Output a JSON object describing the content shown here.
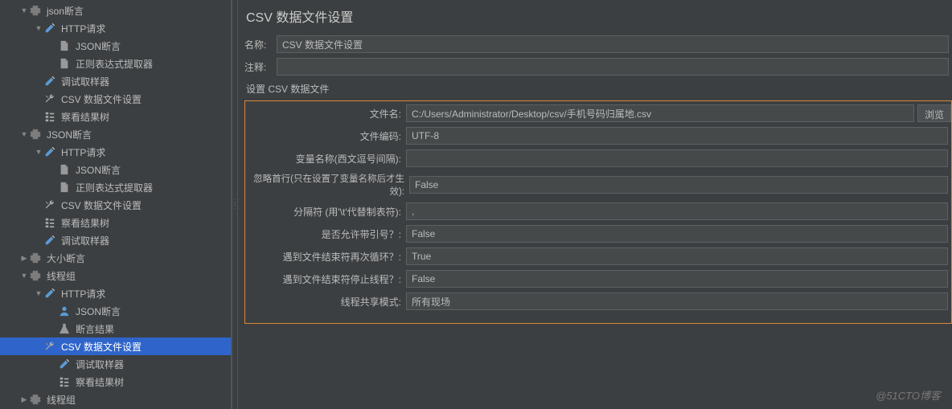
{
  "tree": [
    {
      "indent": 1,
      "arrow": "down",
      "icon": "gear",
      "label": "json断言"
    },
    {
      "indent": 2,
      "arrow": "down",
      "icon": "pen",
      "label": "HTTP请求"
    },
    {
      "indent": 3,
      "arrow": "",
      "icon": "doc",
      "label": "JSON断言"
    },
    {
      "indent": 3,
      "arrow": "",
      "icon": "doc",
      "label": "正则表达式提取器"
    },
    {
      "indent": 2,
      "arrow": "",
      "icon": "pen",
      "label": "调试取样器"
    },
    {
      "indent": 2,
      "arrow": "",
      "icon": "wrench",
      "label": "CSV 数据文件设置"
    },
    {
      "indent": 2,
      "arrow": "",
      "icon": "tree",
      "label": "察看结果树"
    },
    {
      "indent": 1,
      "arrow": "down",
      "icon": "gear",
      "label": "JSON断言"
    },
    {
      "indent": 2,
      "arrow": "down",
      "icon": "pen",
      "label": "HTTP请求"
    },
    {
      "indent": 3,
      "arrow": "",
      "icon": "doc",
      "label": "JSON断言"
    },
    {
      "indent": 3,
      "arrow": "",
      "icon": "doc",
      "label": "正则表达式提取器"
    },
    {
      "indent": 2,
      "arrow": "",
      "icon": "wrench",
      "label": "CSV 数据文件设置"
    },
    {
      "indent": 2,
      "arrow": "",
      "icon": "tree",
      "label": "察看结果树"
    },
    {
      "indent": 2,
      "arrow": "",
      "icon": "pen",
      "label": "调试取样器"
    },
    {
      "indent": 1,
      "arrow": "right",
      "icon": "gear",
      "label": "大小断言"
    },
    {
      "indent": 1,
      "arrow": "down",
      "icon": "gear",
      "label": "线程组"
    },
    {
      "indent": 2,
      "arrow": "down",
      "icon": "pen",
      "label": "HTTP请求"
    },
    {
      "indent": 3,
      "arrow": "",
      "icon": "person",
      "label": "JSON断言"
    },
    {
      "indent": 3,
      "arrow": "",
      "icon": "beaker",
      "label": "断言结果"
    },
    {
      "indent": 2,
      "arrow": "",
      "icon": "wrench",
      "label": "CSV 数据文件设置",
      "selected": true
    },
    {
      "indent": 3,
      "arrow": "",
      "icon": "pen",
      "label": "调试取样器"
    },
    {
      "indent": 3,
      "arrow": "",
      "icon": "tree",
      "label": "察看结果树"
    },
    {
      "indent": 1,
      "arrow": "right",
      "icon": "gear",
      "label": "线程组"
    }
  ],
  "main": {
    "title": "CSV 数据文件设置",
    "name_label": "名称:",
    "name_value": "CSV 数据文件设置",
    "comment_label": "注释:",
    "comment_value": "",
    "section_title": "设置 CSV 数据文件",
    "browse": "浏览",
    "fields": [
      {
        "label": "文件名:",
        "value": "C:/Users/Administrator/Desktop/csv/手机号码归属地.csv",
        "browse": true
      },
      {
        "label": "文件编码:",
        "value": "UTF-8"
      },
      {
        "label": "变量名称(西文逗号间隔):",
        "value": ""
      },
      {
        "label": "忽略首行(只在设置了变量名称后才生效):",
        "value": "False"
      },
      {
        "label": "分隔符 (用'\\t'代替制表符):",
        "value": ","
      },
      {
        "label": "是否允许带引号？:",
        "value": "False"
      },
      {
        "label": "遇到文件结束符再次循环？:",
        "value": "True"
      },
      {
        "label": "遇到文件结束符停止线程？:",
        "value": "False"
      },
      {
        "label": "线程共享模式:",
        "value": "所有现场"
      }
    ]
  },
  "watermark": "@51CTO博客"
}
